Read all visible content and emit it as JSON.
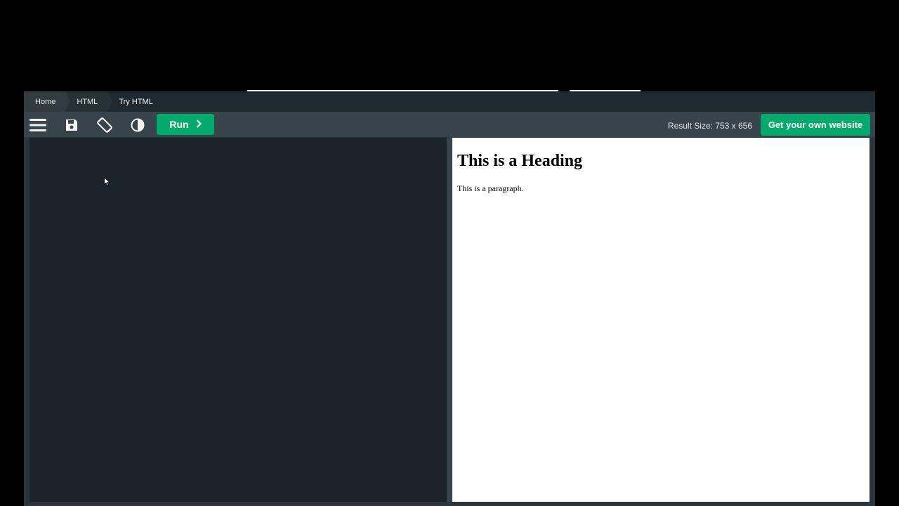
{
  "breadcrumbs": [
    {
      "label": "Home"
    },
    {
      "label": "HTML"
    },
    {
      "label": "Try HTML"
    }
  ],
  "toolbar": {
    "icons": [
      "menu-icon",
      "save-icon",
      "rotate-layout-icon",
      "contrast-icon"
    ],
    "run_label": "Run",
    "result_size": "Result Size: 753 x 656",
    "own_website_label": "Get your own website"
  },
  "result": {
    "heading": "This is a Heading",
    "paragraph": "This is a paragraph."
  },
  "colors": {
    "accent": "#04aa6d",
    "editor_bg": "#1b232b",
    "toolbar_bg": "#38444b"
  }
}
